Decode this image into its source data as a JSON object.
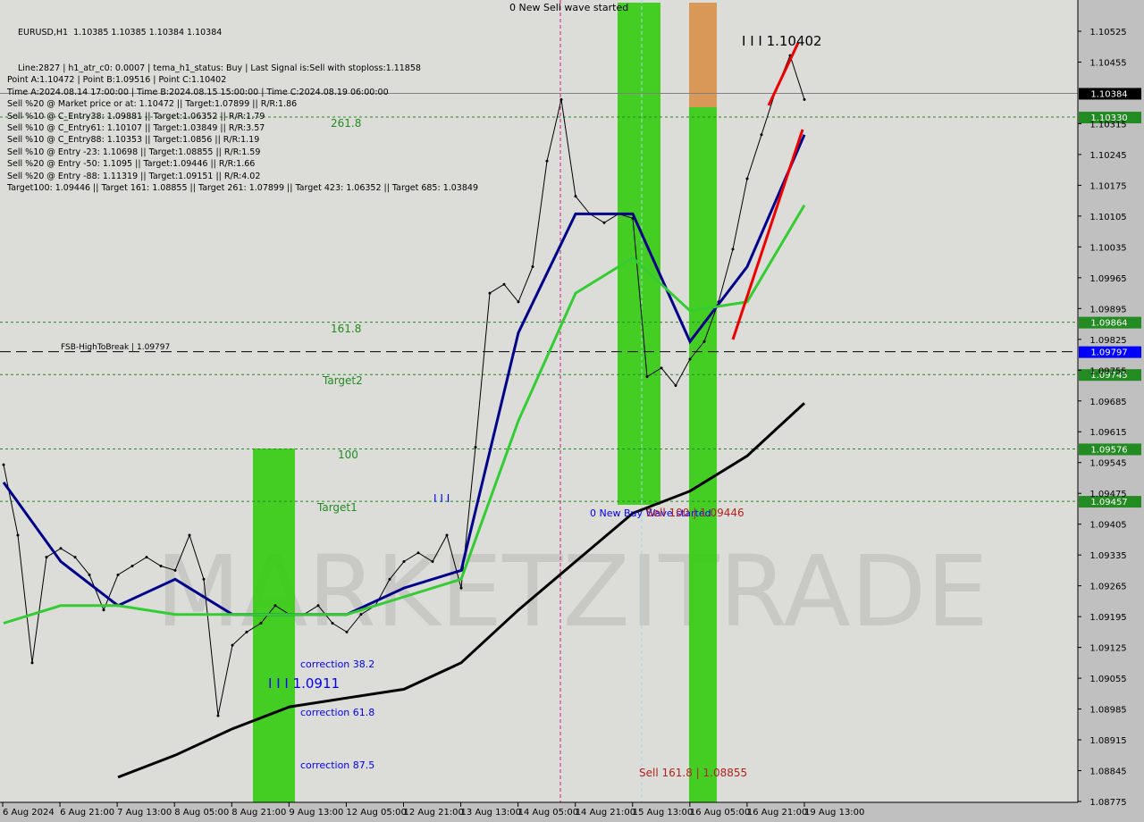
{
  "header": {
    "title": "EURUSD,H1  1.10385 1.10385 1.10384 1.10384",
    "lines": [
      "Line:2827 | h1_atr_c0: 0.0007 | tema_h1_status: Buy | Last Signal is:Sell with stoploss:1.11858",
      "Point A:1.10472 | Point B:1.09516 | Point C:1.10402",
      "Time A:2024.08.14 17:00:00 | Time B:2024.08.15 15:00:00 | Time C:2024.08.19 06:00:00",
      "Sell %20 @ Market price or at: 1.10472 || Target:1.07899 || R/R:1.86",
      "Sell %10 @ C_Entry38: 1.09881 || Target:1.06352 || R/R:1.79",
      "Sell %10 @ C_Entry61: 1.10107 || Target:1.03849 || R/R:3.57",
      "Sell %10 @ C_Entry88: 1.10353 || Target:1.0856 || R/R:1.19",
      "Sell %10 @ Entry -23: 1.10698 || Target:1.08855 || R/R:1.59",
      "Sell %20 @ Entry -50: 1.1095 || Target:1.09446 || R/R:1.66",
      "Sell %20 @ Entry -88: 1.11319 || Target:1.09151 || R/R:4.02",
      "Target100: 1.09446 || Target 161: 1.08855 || Target 261: 1.07899 || Target 423: 1.06352 || Target 685: 1.03849"
    ]
  },
  "chart_data": {
    "type": "line",
    "ylim": [
      1.08775,
      1.10525
    ],
    "grid": false,
    "y_ticks": [
      "1.10525",
      "1.10455",
      "1.10315",
      "1.10245",
      "1.10175",
      "1.10105",
      "1.10035",
      "1.09965",
      "1.09895",
      "1.09825",
      "1.09755",
      "1.09685",
      "1.09615",
      "1.09545",
      "1.09475",
      "1.09405",
      "1.09335",
      "1.09265",
      "1.09195",
      "1.09125",
      "1.09055",
      "1.08985",
      "1.08915",
      "1.08845",
      "1.08775"
    ],
    "x_ticks": [
      "6 Aug 2024",
      "6 Aug 21:00",
      "7 Aug 13:00",
      "8 Aug 05:00",
      "8 Aug 21:00",
      "9 Aug 13:00",
      "12 Aug 05:00",
      "12 Aug 21:00",
      "13 Aug 13:00",
      "14 Aug 05:00",
      "14 Aug 21:00",
      "15 Aug 13:00",
      "16 Aug 05:00",
      "16 Aug 21:00",
      "19 Aug 13:00"
    ],
    "series": [
      {
        "role": "price",
        "color": "#000000",
        "values": [
          1.0954,
          1.0938,
          1.0909,
          1.0933,
          1.0935,
          1.0933,
          1.0929,
          1.0921,
          1.0929,
          1.0931,
          1.0933,
          1.0931,
          1.093,
          1.0938,
          1.0928,
          1.0897,
          1.0913,
          1.0916,
          1.0918,
          1.0922,
          1.092,
          1.092,
          1.0922,
          1.0918,
          1.0916,
          1.092,
          1.0922,
          1.0928,
          1.0932,
          1.0934,
          1.0932,
          1.0938,
          1.0926,
          1.0958,
          1.0993,
          1.0995,
          1.0991,
          1.0999,
          1.1023,
          1.1037,
          1.1015,
          1.1011,
          1.1009,
          1.1011,
          1.101,
          1.0974,
          1.0976,
          1.0972,
          1.0978,
          1.0982,
          1.0991,
          1.1003,
          1.1019,
          1.1029,
          1.1039,
          1.1047,
          1.1037
        ]
      },
      {
        "role": "ma-blue",
        "color": "#00008b",
        "values": [
          1.095,
          1.0932,
          1.0922,
          1.0928,
          1.092,
          1.092,
          1.092,
          1.0926,
          1.093,
          1.0984,
          1.1011,
          1.1011,
          1.0982,
          1.0999,
          1.1029
        ]
      },
      {
        "role": "ma-green",
        "color": "#33cc33",
        "values": [
          1.0918,
          1.0922,
          1.0922,
          1.092,
          1.092,
          1.092,
          1.092,
          1.0924,
          1.0928,
          1.0964,
          1.0993,
          1.1001,
          1.0989,
          1.0991,
          1.1013
        ]
      },
      {
        "role": "ma-black",
        "color": "#000000",
        "values": [
          null,
          null,
          1.0883,
          1.0888,
          1.0894,
          1.0899,
          1.0901,
          1.0903,
          1.0909,
          1.0921,
          1.0932,
          1.0943,
          1.0948,
          1.0956,
          1.0968
        ]
      }
    ],
    "levels": [
      {
        "value": "1.10384",
        "style": "solid",
        "color": "#808080",
        "tag": "#000000"
      },
      {
        "value": "1.10330",
        "style": "dotted",
        "color": "#228b22",
        "tag": "#228b22"
      },
      {
        "value": "1.09864",
        "style": "dotted",
        "color": "#228b22",
        "tag": "#228b22"
      },
      {
        "value": "1.09797",
        "style": "dashed",
        "color": "#000000",
        "tag": "#0000ff"
      },
      {
        "value": "1.09745",
        "style": "dotted",
        "color": "#228b22",
        "tag": "#228b22"
      },
      {
        "value": "1.09576",
        "style": "dotted",
        "color": "#228b22",
        "tag": "#228b22"
      },
      {
        "value": "1.09457",
        "style": "dotted",
        "color": "#228b22",
        "tag": "#228b22"
      }
    ],
    "annotations": [
      {
        "text": "0 New Sell wave started",
        "color": "#000000"
      },
      {
        "text": "I I I 1.10402",
        "color": "#000000"
      },
      {
        "text": "261.8",
        "color": "#228b22"
      },
      {
        "text": "161.8",
        "color": "#228b22"
      },
      {
        "text": "Target2",
        "color": "#228b22"
      },
      {
        "text": "100",
        "color": "#228b22"
      },
      {
        "text": "Target1",
        "color": "#228b22"
      },
      {
        "text": "FSB-HighToBreak | 1.09797",
        "color": "#000000"
      },
      {
        "text": "0 New Buy Wave started",
        "color": "#0000ff"
      },
      {
        "text": "Sell 100 | 1.09446",
        "color": "#b22222"
      },
      {
        "text": "I I I",
        "color": "#0000ff"
      },
      {
        "text": "I I I 1.0911",
        "color": "#0000ff"
      },
      {
        "text": "correction 38.2",
        "color": "#0000ff"
      },
      {
        "text": "correction 61.8",
        "color": "#0000ff"
      },
      {
        "text": "correction 87.5",
        "color": "#0000ff"
      },
      {
        "text": "Sell 161.8 | 1.08855",
        "color": "#b22222"
      }
    ]
  }
}
